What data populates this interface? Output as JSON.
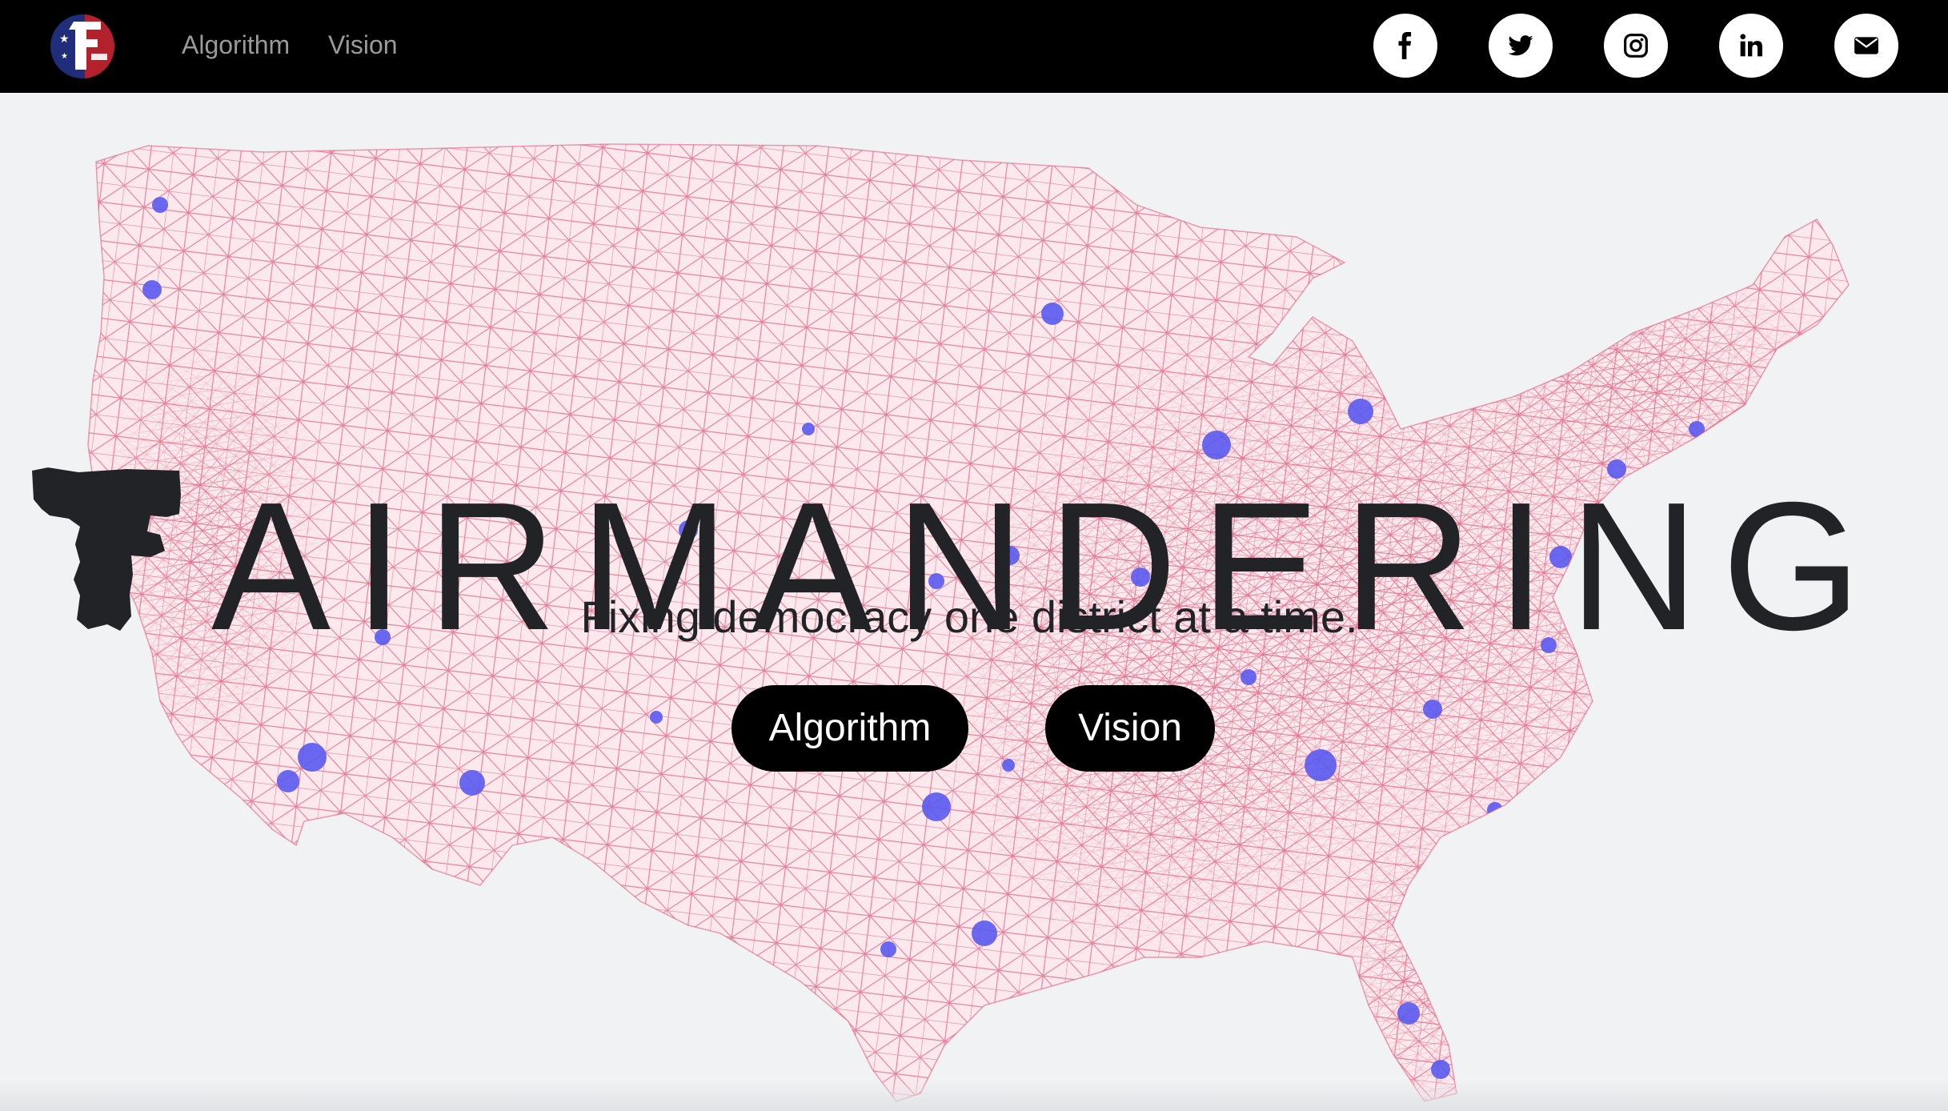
{
  "nav": {
    "logo_icon": "fairmandering-logo-icon",
    "links": [
      {
        "label": "Algorithm"
      },
      {
        "label": "Vision"
      }
    ],
    "social": [
      {
        "icon": "facebook-icon"
      },
      {
        "icon": "twitter-icon"
      },
      {
        "icon": "instagram-icon"
      },
      {
        "icon": "linkedin-icon"
      },
      {
        "icon": "email-icon"
      }
    ]
  },
  "hero": {
    "title_first_letter_icon": "f-logo-glyph",
    "title_rest": "AIRMANDERING",
    "tagline": "Fixing democracy one district at a time.",
    "background_icon": "us-precinct-map-image",
    "buttons": [
      {
        "label": "Algorithm"
      },
      {
        "label": "Vision"
      }
    ]
  },
  "colors": {
    "navbar": "#000000",
    "page_background": "#f1f2f4",
    "mesh_lines": "#e0607e",
    "population_dots": "#5a5af0",
    "title_text": "#212327",
    "button_bg": "#000000",
    "button_text": "#ffffff",
    "nav_link": "#9a9a9a"
  }
}
